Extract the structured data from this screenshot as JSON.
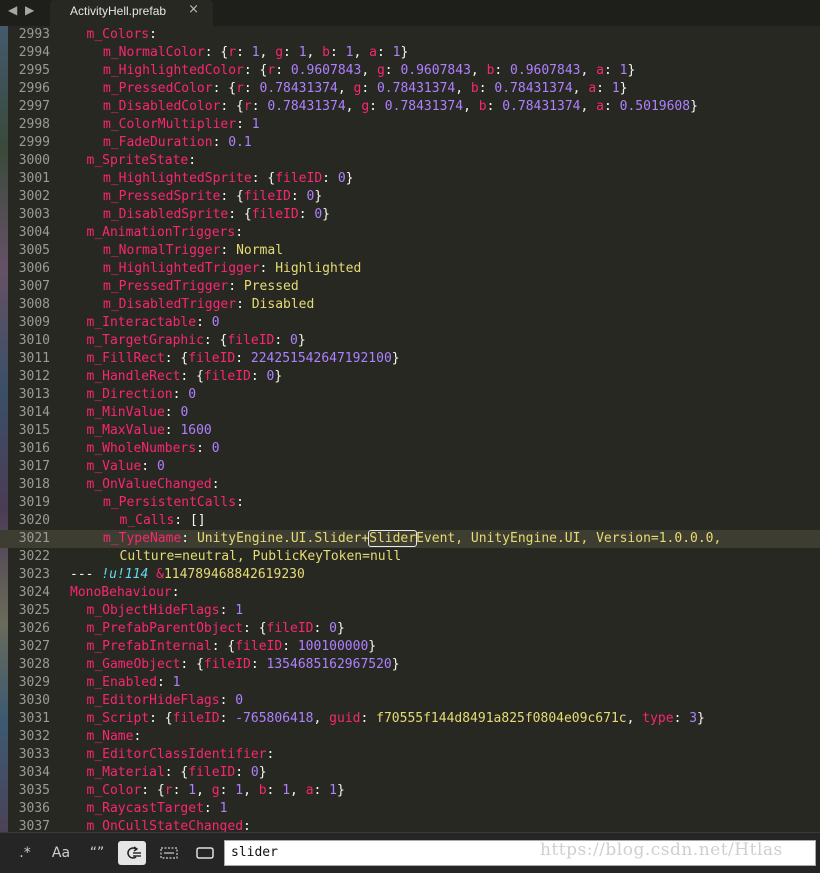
{
  "tab": {
    "title": "ActivityHell.prefab",
    "close": "×",
    "nav": "◀ ▶"
  },
  "lines": [
    {
      "n": "2993",
      "indent": 1,
      "tokens": [
        {
          "c": "k",
          "t": "m_Colors"
        },
        {
          "c": "p",
          "t": ":"
        }
      ]
    },
    {
      "n": "2994",
      "indent": 2,
      "tokens": [
        {
          "c": "k",
          "t": "m_NormalColor"
        },
        {
          "c": "p",
          "t": ": {"
        },
        {
          "c": "k",
          "t": "r"
        },
        {
          "c": "p",
          "t": ": "
        },
        {
          "c": "n",
          "t": "1"
        },
        {
          "c": "p",
          "t": ", "
        },
        {
          "c": "k",
          "t": "g"
        },
        {
          "c": "p",
          "t": ": "
        },
        {
          "c": "n",
          "t": "1"
        },
        {
          "c": "p",
          "t": ", "
        },
        {
          "c": "k",
          "t": "b"
        },
        {
          "c": "p",
          "t": ": "
        },
        {
          "c": "n",
          "t": "1"
        },
        {
          "c": "p",
          "t": ", "
        },
        {
          "c": "k",
          "t": "a"
        },
        {
          "c": "p",
          "t": ": "
        },
        {
          "c": "n",
          "t": "1"
        },
        {
          "c": "p",
          "t": "}"
        }
      ]
    },
    {
      "n": "2995",
      "indent": 2,
      "tokens": [
        {
          "c": "k",
          "t": "m_HighlightedColor"
        },
        {
          "c": "p",
          "t": ": {"
        },
        {
          "c": "k",
          "t": "r"
        },
        {
          "c": "p",
          "t": ": "
        },
        {
          "c": "n",
          "t": "0.9607843"
        },
        {
          "c": "p",
          "t": ", "
        },
        {
          "c": "k",
          "t": "g"
        },
        {
          "c": "p",
          "t": ": "
        },
        {
          "c": "n",
          "t": "0.9607843"
        },
        {
          "c": "p",
          "t": ", "
        },
        {
          "c": "k",
          "t": "b"
        },
        {
          "c": "p",
          "t": ": "
        },
        {
          "c": "n",
          "t": "0.9607843"
        },
        {
          "c": "p",
          "t": ", "
        },
        {
          "c": "k",
          "t": "a"
        },
        {
          "c": "p",
          "t": ": "
        },
        {
          "c": "n",
          "t": "1"
        },
        {
          "c": "p",
          "t": "}"
        }
      ]
    },
    {
      "n": "2996",
      "indent": 2,
      "tokens": [
        {
          "c": "k",
          "t": "m_PressedColor"
        },
        {
          "c": "p",
          "t": ": {"
        },
        {
          "c": "k",
          "t": "r"
        },
        {
          "c": "p",
          "t": ": "
        },
        {
          "c": "n",
          "t": "0.78431374"
        },
        {
          "c": "p",
          "t": ", "
        },
        {
          "c": "k",
          "t": "g"
        },
        {
          "c": "p",
          "t": ": "
        },
        {
          "c": "n",
          "t": "0.78431374"
        },
        {
          "c": "p",
          "t": ", "
        },
        {
          "c": "k",
          "t": "b"
        },
        {
          "c": "p",
          "t": ": "
        },
        {
          "c": "n",
          "t": "0.78431374"
        },
        {
          "c": "p",
          "t": ", "
        },
        {
          "c": "k",
          "t": "a"
        },
        {
          "c": "p",
          "t": ": "
        },
        {
          "c": "n",
          "t": "1"
        },
        {
          "c": "p",
          "t": "}"
        }
      ]
    },
    {
      "n": "2997",
      "indent": 2,
      "tokens": [
        {
          "c": "k",
          "t": "m_DisabledColor"
        },
        {
          "c": "p",
          "t": ": {"
        },
        {
          "c": "k",
          "t": "r"
        },
        {
          "c": "p",
          "t": ": "
        },
        {
          "c": "n",
          "t": "0.78431374"
        },
        {
          "c": "p",
          "t": ", "
        },
        {
          "c": "k",
          "t": "g"
        },
        {
          "c": "p",
          "t": ": "
        },
        {
          "c": "n",
          "t": "0.78431374"
        },
        {
          "c": "p",
          "t": ", "
        },
        {
          "c": "k",
          "t": "b"
        },
        {
          "c": "p",
          "t": ": "
        },
        {
          "c": "n",
          "t": "0.78431374"
        },
        {
          "c": "p",
          "t": ", "
        },
        {
          "c": "k",
          "t": "a"
        },
        {
          "c": "p",
          "t": ": "
        },
        {
          "c": "n",
          "t": "0.5019608"
        },
        {
          "c": "p",
          "t": "}"
        }
      ]
    },
    {
      "n": "2998",
      "indent": 2,
      "tokens": [
        {
          "c": "k",
          "t": "m_ColorMultiplier"
        },
        {
          "c": "p",
          "t": ": "
        },
        {
          "c": "n",
          "t": "1"
        }
      ]
    },
    {
      "n": "2999",
      "indent": 2,
      "tokens": [
        {
          "c": "k",
          "t": "m_FadeDuration"
        },
        {
          "c": "p",
          "t": ": "
        },
        {
          "c": "n",
          "t": "0.1"
        }
      ]
    },
    {
      "n": "3000",
      "indent": 1,
      "tokens": [
        {
          "c": "k",
          "t": "m_SpriteState"
        },
        {
          "c": "p",
          "t": ":"
        }
      ]
    },
    {
      "n": "3001",
      "indent": 2,
      "tokens": [
        {
          "c": "k",
          "t": "m_HighlightedSprite"
        },
        {
          "c": "p",
          "t": ": {"
        },
        {
          "c": "k",
          "t": "fileID"
        },
        {
          "c": "p",
          "t": ": "
        },
        {
          "c": "n",
          "t": "0"
        },
        {
          "c": "p",
          "t": "}"
        }
      ]
    },
    {
      "n": "3002",
      "indent": 2,
      "tokens": [
        {
          "c": "k",
          "t": "m_PressedSprite"
        },
        {
          "c": "p",
          "t": ": {"
        },
        {
          "c": "k",
          "t": "fileID"
        },
        {
          "c": "p",
          "t": ": "
        },
        {
          "c": "n",
          "t": "0"
        },
        {
          "c": "p",
          "t": "}"
        }
      ]
    },
    {
      "n": "3003",
      "indent": 2,
      "tokens": [
        {
          "c": "k",
          "t": "m_DisabledSprite"
        },
        {
          "c": "p",
          "t": ": {"
        },
        {
          "c": "k",
          "t": "fileID"
        },
        {
          "c": "p",
          "t": ": "
        },
        {
          "c": "n",
          "t": "0"
        },
        {
          "c": "p",
          "t": "}"
        }
      ]
    },
    {
      "n": "3004",
      "indent": 1,
      "tokens": [
        {
          "c": "k",
          "t": "m_AnimationTriggers"
        },
        {
          "c": "p",
          "t": ":"
        }
      ]
    },
    {
      "n": "3005",
      "indent": 2,
      "tokens": [
        {
          "c": "k",
          "t": "m_NormalTrigger"
        },
        {
          "c": "p",
          "t": ": "
        },
        {
          "c": "s",
          "t": "Normal"
        }
      ]
    },
    {
      "n": "3006",
      "indent": 2,
      "tokens": [
        {
          "c": "k",
          "t": "m_HighlightedTrigger"
        },
        {
          "c": "p",
          "t": ": "
        },
        {
          "c": "s",
          "t": "Highlighted"
        }
      ]
    },
    {
      "n": "3007",
      "indent": 2,
      "tokens": [
        {
          "c": "k",
          "t": "m_PressedTrigger"
        },
        {
          "c": "p",
          "t": ": "
        },
        {
          "c": "s",
          "t": "Pressed"
        }
      ]
    },
    {
      "n": "3008",
      "indent": 2,
      "tokens": [
        {
          "c": "k",
          "t": "m_DisabledTrigger"
        },
        {
          "c": "p",
          "t": ": "
        },
        {
          "c": "s",
          "t": "Disabled"
        }
      ]
    },
    {
      "n": "3009",
      "indent": 1,
      "tokens": [
        {
          "c": "k",
          "t": "m_Interactable"
        },
        {
          "c": "p",
          "t": ": "
        },
        {
          "c": "n",
          "t": "0"
        }
      ]
    },
    {
      "n": "3010",
      "indent": 1,
      "tokens": [
        {
          "c": "k",
          "t": "m_TargetGraphic"
        },
        {
          "c": "p",
          "t": ": {"
        },
        {
          "c": "k",
          "t": "fileID"
        },
        {
          "c": "p",
          "t": ": "
        },
        {
          "c": "n",
          "t": "0"
        },
        {
          "c": "p",
          "t": "}"
        }
      ]
    },
    {
      "n": "3011",
      "indent": 1,
      "tokens": [
        {
          "c": "k",
          "t": "m_FillRect"
        },
        {
          "c": "p",
          "t": ": {"
        },
        {
          "c": "k",
          "t": "fileID"
        },
        {
          "c": "p",
          "t": ": "
        },
        {
          "c": "n",
          "t": "224251542647192100"
        },
        {
          "c": "p",
          "t": "}"
        }
      ]
    },
    {
      "n": "3012",
      "indent": 1,
      "tokens": [
        {
          "c": "k",
          "t": "m_HandleRect"
        },
        {
          "c": "p",
          "t": ": {"
        },
        {
          "c": "k",
          "t": "fileID"
        },
        {
          "c": "p",
          "t": ": "
        },
        {
          "c": "n",
          "t": "0"
        },
        {
          "c": "p",
          "t": "}"
        }
      ]
    },
    {
      "n": "3013",
      "indent": 1,
      "tokens": [
        {
          "c": "k",
          "t": "m_Direction"
        },
        {
          "c": "p",
          "t": ": "
        },
        {
          "c": "n",
          "t": "0"
        }
      ]
    },
    {
      "n": "3014",
      "indent": 1,
      "tokens": [
        {
          "c": "k",
          "t": "m_MinValue"
        },
        {
          "c": "p",
          "t": ": "
        },
        {
          "c": "n",
          "t": "0"
        }
      ]
    },
    {
      "n": "3015",
      "indent": 1,
      "tokens": [
        {
          "c": "k",
          "t": "m_MaxValue"
        },
        {
          "c": "p",
          "t": ": "
        },
        {
          "c": "n",
          "t": "1600"
        }
      ]
    },
    {
      "n": "3016",
      "indent": 1,
      "tokens": [
        {
          "c": "k",
          "t": "m_WholeNumbers"
        },
        {
          "c": "p",
          "t": ": "
        },
        {
          "c": "n",
          "t": "0"
        }
      ]
    },
    {
      "n": "3017",
      "indent": 1,
      "tokens": [
        {
          "c": "k",
          "t": "m_Value"
        },
        {
          "c": "p",
          "t": ": "
        },
        {
          "c": "n",
          "t": "0"
        }
      ]
    },
    {
      "n": "3018",
      "indent": 1,
      "tokens": [
        {
          "c": "k",
          "t": "m_OnValueChanged"
        },
        {
          "c": "p",
          "t": ":"
        }
      ]
    },
    {
      "n": "3019",
      "indent": 2,
      "tokens": [
        {
          "c": "k",
          "t": "m_PersistentCalls"
        },
        {
          "c": "p",
          "t": ":"
        }
      ]
    },
    {
      "n": "3020",
      "indent": 3,
      "tokens": [
        {
          "c": "k",
          "t": "m_Calls"
        },
        {
          "c": "p",
          "t": ": []"
        }
      ]
    },
    {
      "n": "3021",
      "indent": 2,
      "current": true,
      "tokens": [
        {
          "c": "k",
          "t": "m_TypeName"
        },
        {
          "c": "p",
          "t": ": "
        },
        {
          "c": "s",
          "t": "UnityEngine.UI.Slider+"
        },
        {
          "c": "sf",
          "t": "Slider"
        },
        {
          "c": "s",
          "t": "Event, UnityEngine.UI, Version=1.0.0.0,"
        }
      ]
    },
    {
      "n": "3022",
      "indent": 3,
      "tokens": [
        {
          "c": "s",
          "t": "Culture=neutral, PublicKeyToken=null"
        }
      ]
    },
    {
      "n": "3023",
      "indent": 0,
      "tokens": [
        {
          "c": "p",
          "t": "--- "
        },
        {
          "c": "t",
          "t": "!u!114"
        },
        {
          "c": "p",
          "t": " "
        },
        {
          "c": "k",
          "t": "&"
        },
        {
          "c": "s",
          "t": "114789468842619230"
        }
      ]
    },
    {
      "n": "3024",
      "indent": 0,
      "tokens": [
        {
          "c": "k",
          "t": "MonoBehaviour"
        },
        {
          "c": "p",
          "t": ":"
        }
      ]
    },
    {
      "n": "3025",
      "indent": 1,
      "tokens": [
        {
          "c": "k",
          "t": "m_ObjectHideFlags"
        },
        {
          "c": "p",
          "t": ": "
        },
        {
          "c": "n",
          "t": "1"
        }
      ]
    },
    {
      "n": "3026",
      "indent": 1,
      "tokens": [
        {
          "c": "k",
          "t": "m_PrefabParentObject"
        },
        {
          "c": "p",
          "t": ": {"
        },
        {
          "c": "k",
          "t": "fileID"
        },
        {
          "c": "p",
          "t": ": "
        },
        {
          "c": "n",
          "t": "0"
        },
        {
          "c": "p",
          "t": "}"
        }
      ]
    },
    {
      "n": "3027",
      "indent": 1,
      "tokens": [
        {
          "c": "k",
          "t": "m_PrefabInternal"
        },
        {
          "c": "p",
          "t": ": {"
        },
        {
          "c": "k",
          "t": "fileID"
        },
        {
          "c": "p",
          "t": ": "
        },
        {
          "c": "n",
          "t": "100100000"
        },
        {
          "c": "p",
          "t": "}"
        }
      ]
    },
    {
      "n": "3028",
      "indent": 1,
      "tokens": [
        {
          "c": "k",
          "t": "m_GameObject"
        },
        {
          "c": "p",
          "t": ": {"
        },
        {
          "c": "k",
          "t": "fileID"
        },
        {
          "c": "p",
          "t": ": "
        },
        {
          "c": "n",
          "t": "1354685162967520"
        },
        {
          "c": "p",
          "t": "}"
        }
      ]
    },
    {
      "n": "3029",
      "indent": 1,
      "tokens": [
        {
          "c": "k",
          "t": "m_Enabled"
        },
        {
          "c": "p",
          "t": ": "
        },
        {
          "c": "n",
          "t": "1"
        }
      ]
    },
    {
      "n": "3030",
      "indent": 1,
      "tokens": [
        {
          "c": "k",
          "t": "m_EditorHideFlags"
        },
        {
          "c": "p",
          "t": ": "
        },
        {
          "c": "n",
          "t": "0"
        }
      ]
    },
    {
      "n": "3031",
      "indent": 1,
      "tokens": [
        {
          "c": "k",
          "t": "m_Script"
        },
        {
          "c": "p",
          "t": ": {"
        },
        {
          "c": "k",
          "t": "fileID"
        },
        {
          "c": "p",
          "t": ": "
        },
        {
          "c": "n",
          "t": "-765806418"
        },
        {
          "c": "p",
          "t": ", "
        },
        {
          "c": "k",
          "t": "guid"
        },
        {
          "c": "p",
          "t": ": "
        },
        {
          "c": "s",
          "t": "f70555f144d8491a825f0804e09c671c"
        },
        {
          "c": "p",
          "t": ", "
        },
        {
          "c": "k",
          "t": "type"
        },
        {
          "c": "p",
          "t": ": "
        },
        {
          "c": "n",
          "t": "3"
        },
        {
          "c": "p",
          "t": "}"
        }
      ]
    },
    {
      "n": "3032",
      "indent": 1,
      "tokens": [
        {
          "c": "k",
          "t": "m_Name"
        },
        {
          "c": "p",
          "t": ":"
        }
      ]
    },
    {
      "n": "3033",
      "indent": 1,
      "tokens": [
        {
          "c": "k",
          "t": "m_EditorClassIdentifier"
        },
        {
          "c": "p",
          "t": ":"
        }
      ]
    },
    {
      "n": "3034",
      "indent": 1,
      "tokens": [
        {
          "c": "k",
          "t": "m_Material"
        },
        {
          "c": "p",
          "t": ": {"
        },
        {
          "c": "k",
          "t": "fileID"
        },
        {
          "c": "p",
          "t": ": "
        },
        {
          "c": "n",
          "t": "0"
        },
        {
          "c": "p",
          "t": "}"
        }
      ]
    },
    {
      "n": "3035",
      "indent": 1,
      "tokens": [
        {
          "c": "k",
          "t": "m_Color"
        },
        {
          "c": "p",
          "t": ": {"
        },
        {
          "c": "k",
          "t": "r"
        },
        {
          "c": "p",
          "t": ": "
        },
        {
          "c": "n",
          "t": "1"
        },
        {
          "c": "p",
          "t": ", "
        },
        {
          "c": "k",
          "t": "g"
        },
        {
          "c": "p",
          "t": ": "
        },
        {
          "c": "n",
          "t": "1"
        },
        {
          "c": "p",
          "t": ", "
        },
        {
          "c": "k",
          "t": "b"
        },
        {
          "c": "p",
          "t": ": "
        },
        {
          "c": "n",
          "t": "1"
        },
        {
          "c": "p",
          "t": ", "
        },
        {
          "c": "k",
          "t": "a"
        },
        {
          "c": "p",
          "t": ": "
        },
        {
          "c": "n",
          "t": "1"
        },
        {
          "c": "p",
          "t": "}"
        }
      ]
    },
    {
      "n": "3036",
      "indent": 1,
      "tokens": [
        {
          "c": "k",
          "t": "m_RaycastTarget"
        },
        {
          "c": "p",
          "t": ": "
        },
        {
          "c": "n",
          "t": "1"
        }
      ]
    },
    {
      "n": "3037",
      "indent": 1,
      "tokens": [
        {
          "c": "k",
          "t": "m_OnCullStateChanged"
        },
        {
          "c": "p",
          "t": ":"
        }
      ]
    }
  ],
  "findbar": {
    "regex_label": ".*",
    "case_label": "Aa",
    "word_label": "“”",
    "wrap_icon": "wrap-icon",
    "selection_icon": "in-selection-icon",
    "highlight_icon": "highlight-matches-icon",
    "query": "slider"
  },
  "watermark": "https://blog.csdn.net/Htlas",
  "colors": {
    "background": "#272822",
    "keyword": "#f92672",
    "number": "#ae81ff",
    "string": "#e6db74",
    "tag": "#66d9ef"
  }
}
